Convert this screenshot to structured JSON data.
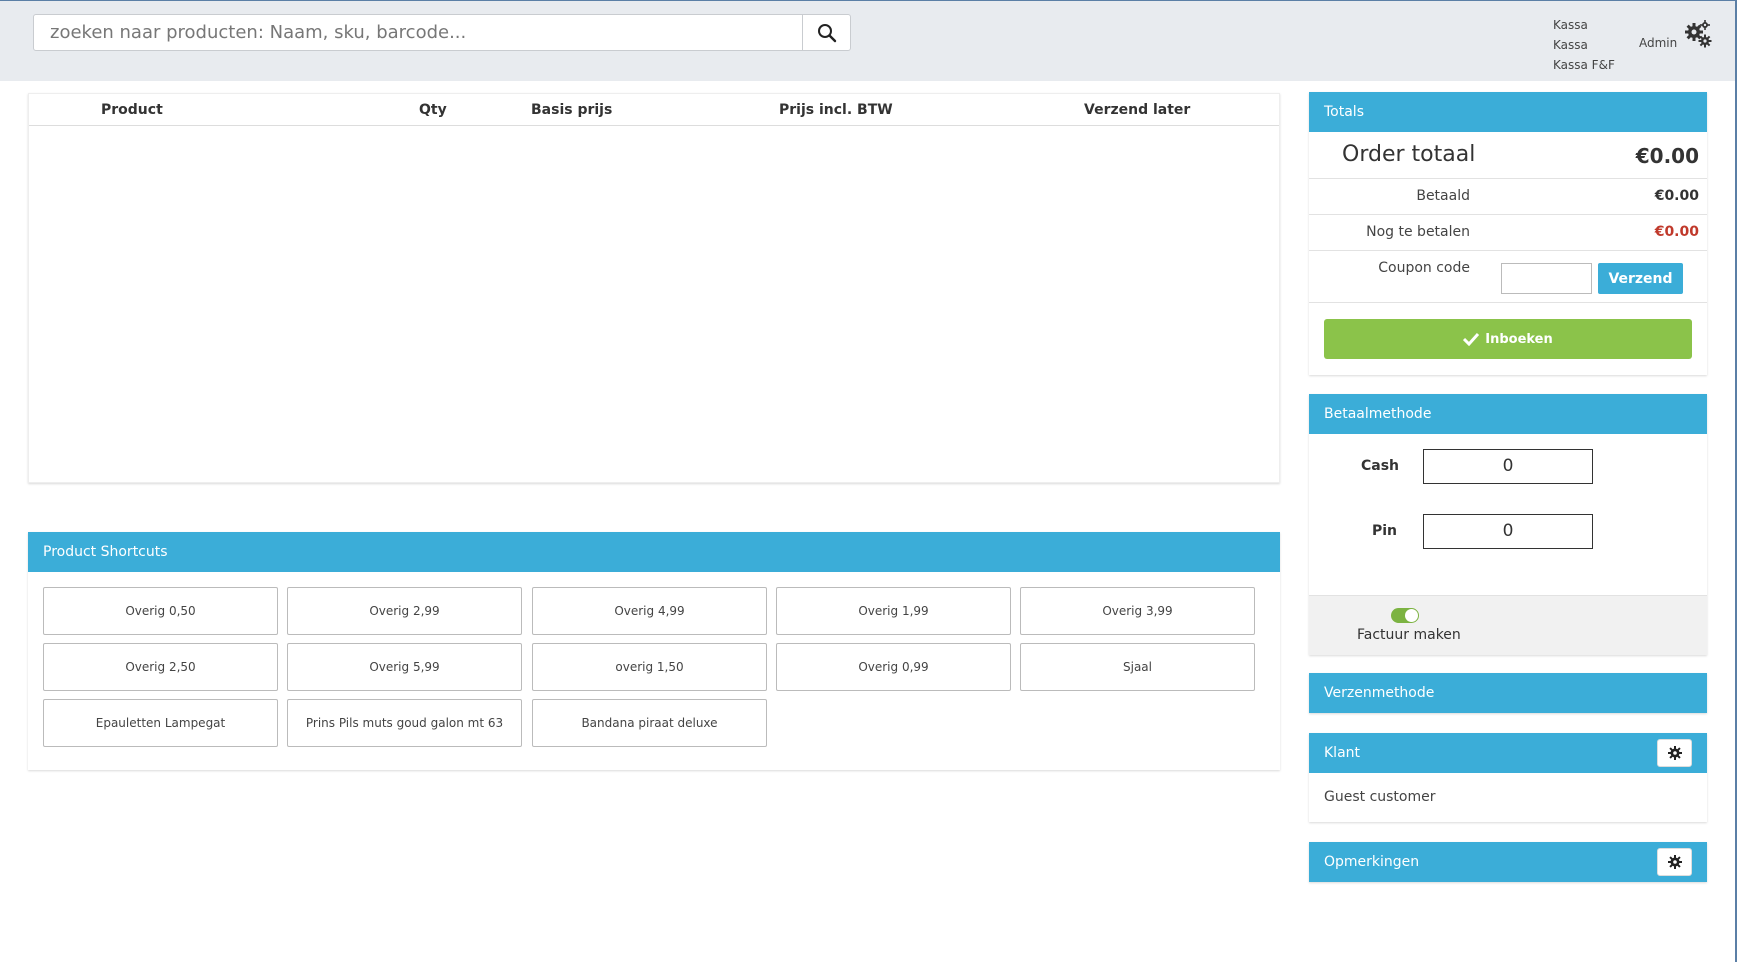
{
  "search": {
    "placeholder": "zoeken naar producten: Naam, sku, barcode...",
    "button_icon": "search-icon"
  },
  "user": {
    "line1": "Kassa",
    "line2": "Kassa",
    "line3": "Kassa F&F",
    "role": "Admin",
    "settings_icon": "gears-icon"
  },
  "cart": {
    "columns": [
      "Product",
      "Qty",
      "Basis prijs",
      "Prijs incl. BTW",
      "Verzend later"
    ]
  },
  "shortcuts": {
    "title": "Product Shortcuts",
    "items": [
      "Overig 0,50",
      "Overig 2,99",
      "Overig 4,99",
      "Overig 1,99",
      "Overig 3,99",
      "Overig 2,50",
      "Overig 5,99",
      "overig 1,50",
      "Overig 0,99",
      "Sjaal",
      "Epauletten Lampegat",
      "Prins Pils muts goud galon mt 63",
      "Bandana piraat deluxe"
    ]
  },
  "totals": {
    "title": "Totals",
    "order_label": "Order totaal",
    "order_value": "€0.00",
    "paid_label": "Betaald",
    "paid_value": "€0.00",
    "due_label": "Nog te betalen",
    "due_value": "€0.00",
    "coupon_label": "Coupon code",
    "coupon_value": "",
    "coupon_button": "Verzend",
    "book_button": "Inboeken",
    "due_color": "#c0392b"
  },
  "payment": {
    "title": "Betaalmethode",
    "cash_label": "Cash",
    "cash_value": "0",
    "pin_label": "Pin",
    "pin_value": "0",
    "invoice_label": "Factuur maken",
    "invoice_enabled": true
  },
  "shipping": {
    "title": "Verzenmethode"
  },
  "customer": {
    "title": "Klant",
    "name": "Guest customer"
  },
  "notes": {
    "title": "Opmerkingen"
  },
  "colors": {
    "accent": "#3badd8",
    "success": "#8bc34a",
    "topbar": "#e8ebef"
  }
}
